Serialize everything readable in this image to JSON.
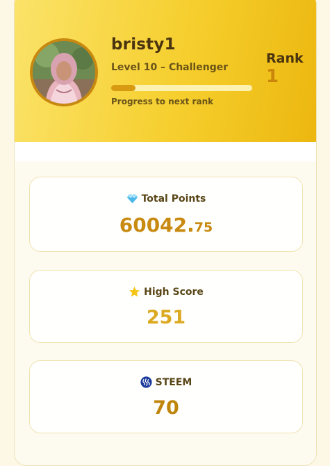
{
  "profile": {
    "username": "bristy1",
    "level_text": "Level 10 – Challenger",
    "progress_label": "Progress to next rank",
    "progress_fraction": 0.17,
    "rank_label": "Rank",
    "rank_value": "1",
    "avatar_icon": "user-avatar-photo"
  },
  "stats": {
    "total_points": {
      "label": "Total Points",
      "value_int": "60042.",
      "value_dec": "75",
      "icon": "diamond-icon"
    },
    "high_score": {
      "label": "High Score",
      "value": "251",
      "icon": "star-icon"
    },
    "steem": {
      "label": "STEEM",
      "value": "70",
      "icon": "steem-logo-icon"
    }
  },
  "colors": {
    "header_gradient_start": "#fbe36a",
    "header_gradient_end": "#ecb70f",
    "accent_gold": "#c88a10",
    "text_dark": "#4a3410"
  }
}
